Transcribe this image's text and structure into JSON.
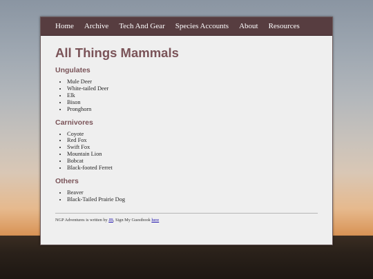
{
  "nav": {
    "items": [
      "Home",
      "Archive",
      "Tech And Gear",
      "Species Accounts",
      "About",
      "Resources"
    ]
  },
  "main": {
    "title": "All Things Mammals",
    "sections": [
      {
        "heading": "Ungulates",
        "items": [
          "Mule Deer",
          "White-tailed Deer",
          "Elk",
          "Bison",
          "Pronghorn"
        ]
      },
      {
        "heading": "Carnivores",
        "items": [
          "Coyote",
          "Red Fox",
          "Swift Fox",
          "Mountain Lion",
          "Bobcat",
          "Black-footed Ferret"
        ]
      },
      {
        "heading": "Others",
        "items": [
          "Beaver",
          "Black-Tailed Prairie Dog"
        ]
      }
    ]
  },
  "footer": {
    "text_before": "NGP Adventures is written by ",
    "author_link": "JB",
    "text_middle": ", Sign My Guestbook ",
    "guestbook_link": "here"
  }
}
